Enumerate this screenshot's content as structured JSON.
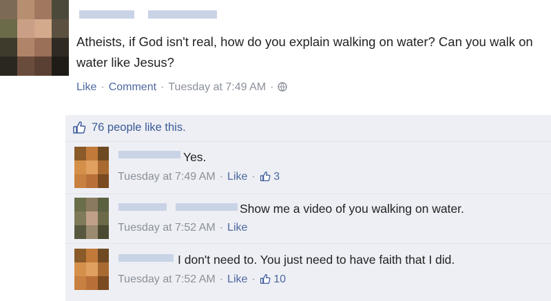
{
  "post": {
    "text": "Atheists, if God isn't real, how do you explain walking on water? Can you walk on water like Jesus?",
    "actions": {
      "like": "Like",
      "comment": "Comment",
      "timestamp": "Tuesday at 7:49 AM",
      "separator": "·"
    },
    "privacy_icon": "globe-icon"
  },
  "likes": {
    "text": "76 people like this.",
    "icon": "thumbs-up-icon"
  },
  "comments": [
    {
      "text": "Yes.",
      "timestamp": "Tuesday at 7:49 AM",
      "like_label": "Like",
      "like_count": "3"
    },
    {
      "text": "Show me a video of you walking on water.",
      "timestamp": "Tuesday at 7:52 AM",
      "like_label": "Like"
    },
    {
      "text": "I don't need to. You just need to have faith that I did.",
      "timestamp": "Tuesday at 7:52 AM",
      "like_label": "Like",
      "like_count": "10"
    }
  ],
  "colors": {
    "link": "#3b5998",
    "meta": "#8a8f99",
    "feedback_bg": "#edeff4",
    "redaction": "#c9d3e6"
  }
}
